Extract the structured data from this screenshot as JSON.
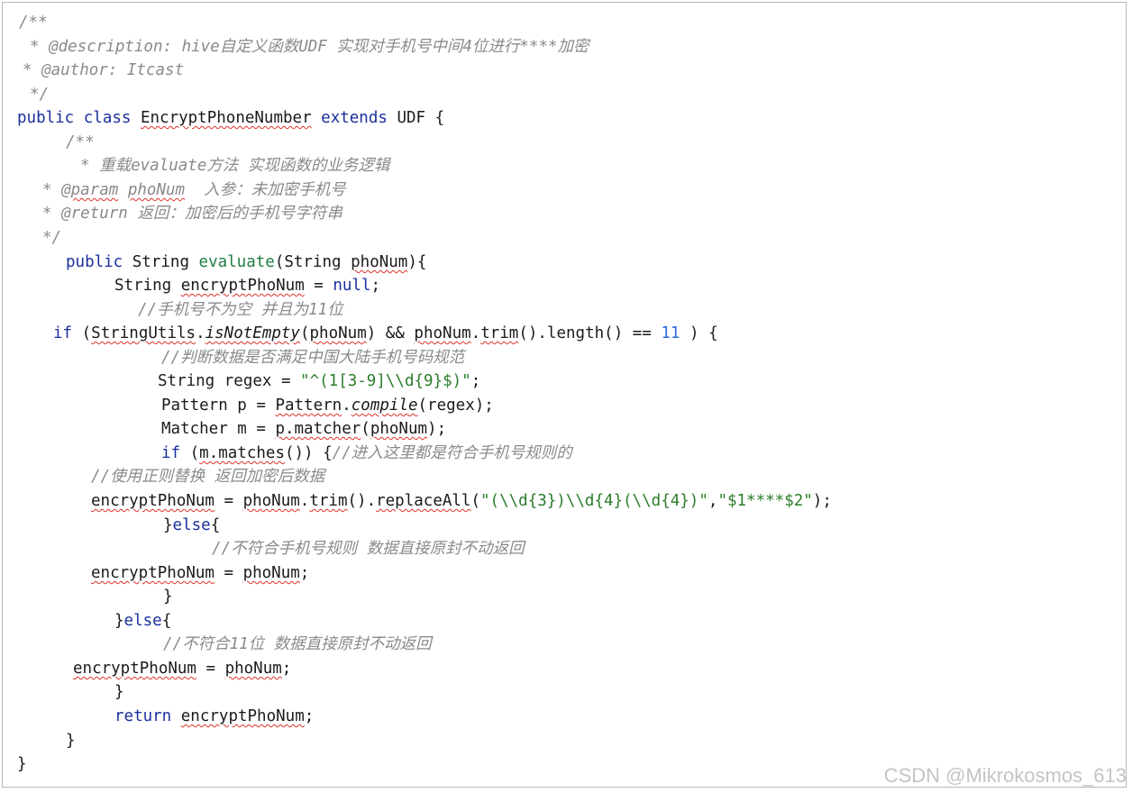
{
  "watermark": "CSDN @Mikrokosmos_613",
  "code_lines": [
    {
      "indent": 18,
      "tokens": [
        {
          "t": "/**",
          "c": "cm"
        }
      ]
    },
    {
      "indent": 30,
      "tokens": [
        {
          "t": "* @description: hive自定义函数UDF 实现对手机号中间4位进行****加密",
          "c": "cm"
        }
      ]
    },
    {
      "indent": 22,
      "tokens": [
        {
          "t": "* @author: Itcast",
          "c": "cm"
        }
      ]
    },
    {
      "indent": 30,
      "tokens": [
        {
          "t": "*/",
          "c": "cm"
        }
      ]
    },
    {
      "indent": 16,
      "tokens": [
        {
          "t": "public class ",
          "c": "kw"
        },
        {
          "t": "EncryptPhoneNumber",
          "c": "wv"
        },
        {
          "t": " extends ",
          "c": "kw"
        },
        {
          "t": "UDF {",
          "c": ""
        }
      ]
    },
    {
      "indent": 70,
      "tokens": [
        {
          "t": "/**",
          "c": "cm"
        }
      ]
    },
    {
      "indent": 86,
      "tokens": [
        {
          "t": "* 重载evaluate方法 实现函数的业务逻辑",
          "c": "cm"
        }
      ]
    },
    {
      "indent": 44,
      "tokens": [
        {
          "t": "* @",
          "c": "cm"
        },
        {
          "t": "param",
          "c": "cm wv"
        },
        {
          "t": " ",
          "c": "cm"
        },
        {
          "t": "phoNum",
          "c": "cm wv"
        },
        {
          "t": "  入参：未加密手机号",
          "c": "cm"
        }
      ]
    },
    {
      "indent": 44,
      "tokens": [
        {
          "t": "* @return 返回：加密后的手机号字符串",
          "c": "cm"
        }
      ]
    },
    {
      "indent": 44,
      "tokens": [
        {
          "t": "*/",
          "c": "cm"
        }
      ]
    },
    {
      "indent": 70,
      "tokens": [
        {
          "t": "public ",
          "c": "kw"
        },
        {
          "t": "String ",
          "c": ""
        },
        {
          "t": "evaluate",
          "c": "mt"
        },
        {
          "t": "(String ",
          "c": ""
        },
        {
          "t": "phoNum",
          "c": "wv"
        },
        {
          "t": "){",
          "c": ""
        }
      ]
    },
    {
      "indent": 124,
      "tokens": [
        {
          "t": "String ",
          "c": ""
        },
        {
          "t": "encryptPhoNum",
          "c": "wv"
        },
        {
          "t": " = ",
          "c": ""
        },
        {
          "t": "null",
          "c": "kw"
        },
        {
          "t": ";",
          "c": ""
        }
      ]
    },
    {
      "indent": 150,
      "tokens": [
        {
          "t": "//手机号不为空 并且为11位",
          "c": "cm"
        }
      ]
    },
    {
      "indent": 56,
      "tokens": [
        {
          "t": "if",
          "c": "kw"
        },
        {
          "t": " (",
          "c": ""
        },
        {
          "t": "StringUtils",
          "c": "wv"
        },
        {
          "t": ".",
          "c": ""
        },
        {
          "t": "isNotEmpty",
          "c": "it wv"
        },
        {
          "t": "(",
          "c": ""
        },
        {
          "t": "phoNum",
          "c": "wv"
        },
        {
          "t": ") && ",
          "c": ""
        },
        {
          "t": "phoNum",
          "c": "wv"
        },
        {
          "t": ".",
          "c": ""
        },
        {
          "t": "trim",
          "c": "wv"
        },
        {
          "t": "().length() == ",
          "c": ""
        },
        {
          "t": "11",
          "c": "nm"
        },
        {
          "t": " ) {",
          "c": ""
        }
      ]
    },
    {
      "indent": 176,
      "tokens": [
        {
          "t": "//判断数据是否满足中国大陆手机号码规范",
          "c": "cm"
        }
      ]
    },
    {
      "indent": 172,
      "tokens": [
        {
          "t": "String regex = ",
          "c": ""
        },
        {
          "t": "\"^(1[3-9]\\\\d{9}$)\"",
          "c": "st"
        },
        {
          "t": ";",
          "c": ""
        }
      ]
    },
    {
      "indent": 176,
      "tokens": [
        {
          "t": "Pattern p = ",
          "c": ""
        },
        {
          "t": "Pattern",
          "c": "wv"
        },
        {
          "t": ".",
          "c": ""
        },
        {
          "t": "compile",
          "c": "it wv"
        },
        {
          "t": "(regex);",
          "c": ""
        }
      ]
    },
    {
      "indent": 176,
      "tokens": [
        {
          "t": "Matcher m = ",
          "c": ""
        },
        {
          "t": "p.matcher",
          "c": "wv"
        },
        {
          "t": "(",
          "c": ""
        },
        {
          "t": "phoNum",
          "c": "wv"
        },
        {
          "t": ");",
          "c": ""
        }
      ]
    },
    {
      "indent": 176,
      "tokens": [
        {
          "t": "if",
          "c": "kw"
        },
        {
          "t": " (",
          "c": ""
        },
        {
          "t": "m.matches",
          "c": "wv"
        },
        {
          "t": "()) {",
          "c": ""
        },
        {
          "t": "//进入这里都是符合手机号规则的",
          "c": "cm"
        }
      ]
    },
    {
      "indent": 98,
      "tokens": [
        {
          "t": "//使用正则替换 返回加密后数据",
          "c": "cm"
        }
      ]
    },
    {
      "indent": 98,
      "tokens": [
        {
          "t": "encryptPhoNum",
          "c": "wv"
        },
        {
          "t": " = ",
          "c": ""
        },
        {
          "t": "phoNum",
          "c": "wv"
        },
        {
          "t": ".",
          "c": ""
        },
        {
          "t": "trim",
          "c": "wv"
        },
        {
          "t": "().",
          "c": ""
        },
        {
          "t": "replaceAll",
          "c": "wv"
        },
        {
          "t": "(",
          "c": ""
        },
        {
          "t": "\"(\\\\d{3})\\\\d{4}(\\\\d{4})\"",
          "c": "st"
        },
        {
          "t": ",",
          "c": ""
        },
        {
          "t": "\"$1****$2\"",
          "c": "st"
        },
        {
          "t": ");",
          "c": ""
        }
      ]
    },
    {
      "indent": 178,
      "tokens": [
        {
          "t": "}",
          "c": ""
        },
        {
          "t": "else",
          "c": "kw"
        },
        {
          "t": "{",
          "c": ""
        }
      ]
    },
    {
      "indent": 232,
      "tokens": [
        {
          "t": "//不符合手机号规则 数据直接原封不动返回",
          "c": "cm"
        }
      ]
    },
    {
      "indent": 98,
      "tokens": [
        {
          "t": "encryptPhoNum",
          "c": "wv"
        },
        {
          "t": " = ",
          "c": ""
        },
        {
          "t": "phoNum",
          "c": "wv"
        },
        {
          "t": ";",
          "c": ""
        }
      ]
    },
    {
      "indent": 178,
      "tokens": [
        {
          "t": "}",
          "c": ""
        }
      ]
    },
    {
      "indent": 124,
      "tokens": [
        {
          "t": "}",
          "c": ""
        },
        {
          "t": "else",
          "c": "kw"
        },
        {
          "t": "{",
          "c": ""
        }
      ]
    },
    {
      "indent": 178,
      "tokens": [
        {
          "t": "//不符合11位 数据直接原封不动返回",
          "c": "cm"
        }
      ]
    },
    {
      "indent": 78,
      "tokens": [
        {
          "t": "encryptPhoNum",
          "c": "wv"
        },
        {
          "t": " = ",
          "c": ""
        },
        {
          "t": "phoNum",
          "c": "wv"
        },
        {
          "t": ";",
          "c": ""
        }
      ]
    },
    {
      "indent": 124,
      "tokens": [
        {
          "t": "}",
          "c": ""
        }
      ]
    },
    {
      "indent": 124,
      "tokens": [
        {
          "t": "return ",
          "c": "kw"
        },
        {
          "t": "encryptPhoNum",
          "c": "wv"
        },
        {
          "t": ";",
          "c": ""
        }
      ]
    },
    {
      "indent": 70,
      "tokens": [
        {
          "t": "}",
          "c": ""
        }
      ]
    },
    {
      "indent": 16,
      "tokens": [
        {
          "t": "}",
          "c": ""
        }
      ]
    }
  ]
}
